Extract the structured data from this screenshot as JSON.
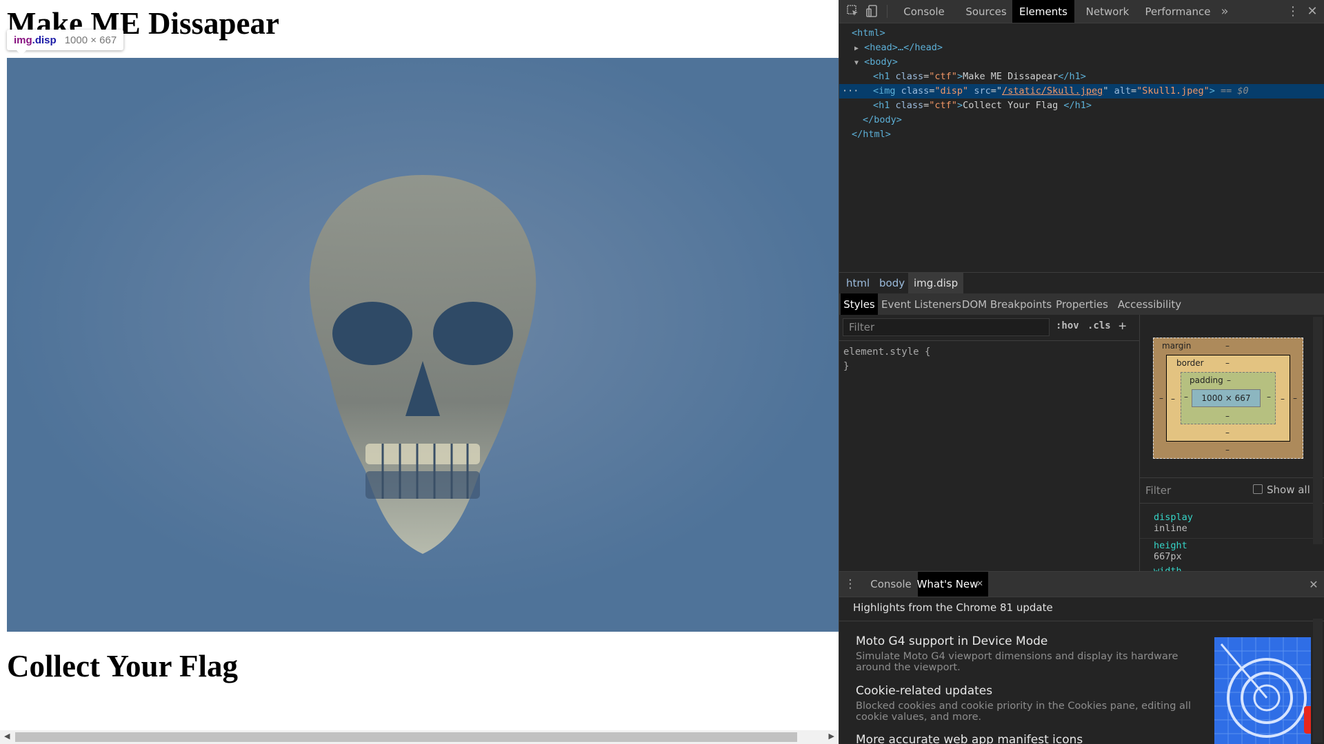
{
  "page": {
    "heading_top": "Make ME Dissapear",
    "heading_bottom": "Collect Your Flag",
    "image_alt": "Skull1.jpeg",
    "tooltip": {
      "tag": "img",
      "cls": ".disp",
      "size": "1000 × 667"
    }
  },
  "devtools": {
    "tabs": [
      "Console",
      "Sources",
      "Elements",
      "Network",
      "Performance"
    ],
    "active_tab": "Elements",
    "more_tabs": "»",
    "dom": {
      "html_open": "<html>",
      "head_collapsed": "<head>…</head>",
      "body_open": "<body>",
      "h1_ctf_1": {
        "open": "<h1 ",
        "attr_name": "class",
        "attr_val": "\"ctf\"",
        "close_open": ">",
        "text": "Make ME Dissapear",
        "end": "</h1>"
      },
      "img_line": {
        "open": "<img ",
        "class_name": "class",
        "class_val": "\"disp\"",
        "src_name": "src",
        "src_val": "/static/Skull.jpeg",
        "alt_name": "alt",
        "alt_val": "\"Skull1.jpeg\"",
        "end": ">",
        "eq": " == $0"
      },
      "h1_ctf_2": {
        "open": "<h1 ",
        "attr_name": "class",
        "attr_val": "\"ctf\"",
        "close_open": ">",
        "text": "Collect Your Flag ",
        "end": "</h1>"
      },
      "body_close": "</body>",
      "html_close": "</html>",
      "ellipsis": "···"
    },
    "breadcrumbs": [
      "html",
      "body",
      "img.disp"
    ],
    "subtabs": [
      "Styles",
      "Event Listeners",
      "DOM Breakpoints",
      "Properties",
      "Accessibility"
    ],
    "active_subtab": "Styles",
    "styles_filter_placeholder": "Filter",
    "hov": ":hov",
    "cls": ".cls",
    "plus": "+",
    "element_style": "element.style {",
    "element_style_close": "}",
    "box_model": {
      "margin_label": "margin",
      "border_label": "border",
      "padding_label": "padding",
      "content": "1000 × 667",
      "dash": "–"
    },
    "computed_filter_placeholder": "Filter",
    "show_all": "Show all",
    "computed": [
      {
        "name": "display",
        "value": "inline"
      },
      {
        "name": "height",
        "value": "667px"
      },
      {
        "name": "width",
        "value": ""
      }
    ],
    "drawer": {
      "tabs": [
        "Console",
        "What's New"
      ],
      "active": "What's New",
      "headline": "Highlights from the Chrome 81 update",
      "items": [
        {
          "title": "Moto G4 support in Device Mode",
          "desc": "Simulate Moto G4 viewport dimensions and display its hardware around the viewport."
        },
        {
          "title": "Cookie-related updates",
          "desc": "Blocked cookies and cookie priority in the Cookies pane, editing all cookie values, and more."
        },
        {
          "title": "More accurate web app manifest icons",
          "desc": ""
        }
      ]
    }
  },
  "colors": {
    "image_tint": "#4f7399",
    "selection": "#063d6b",
    "accent_blue": "#2f6ee6"
  }
}
